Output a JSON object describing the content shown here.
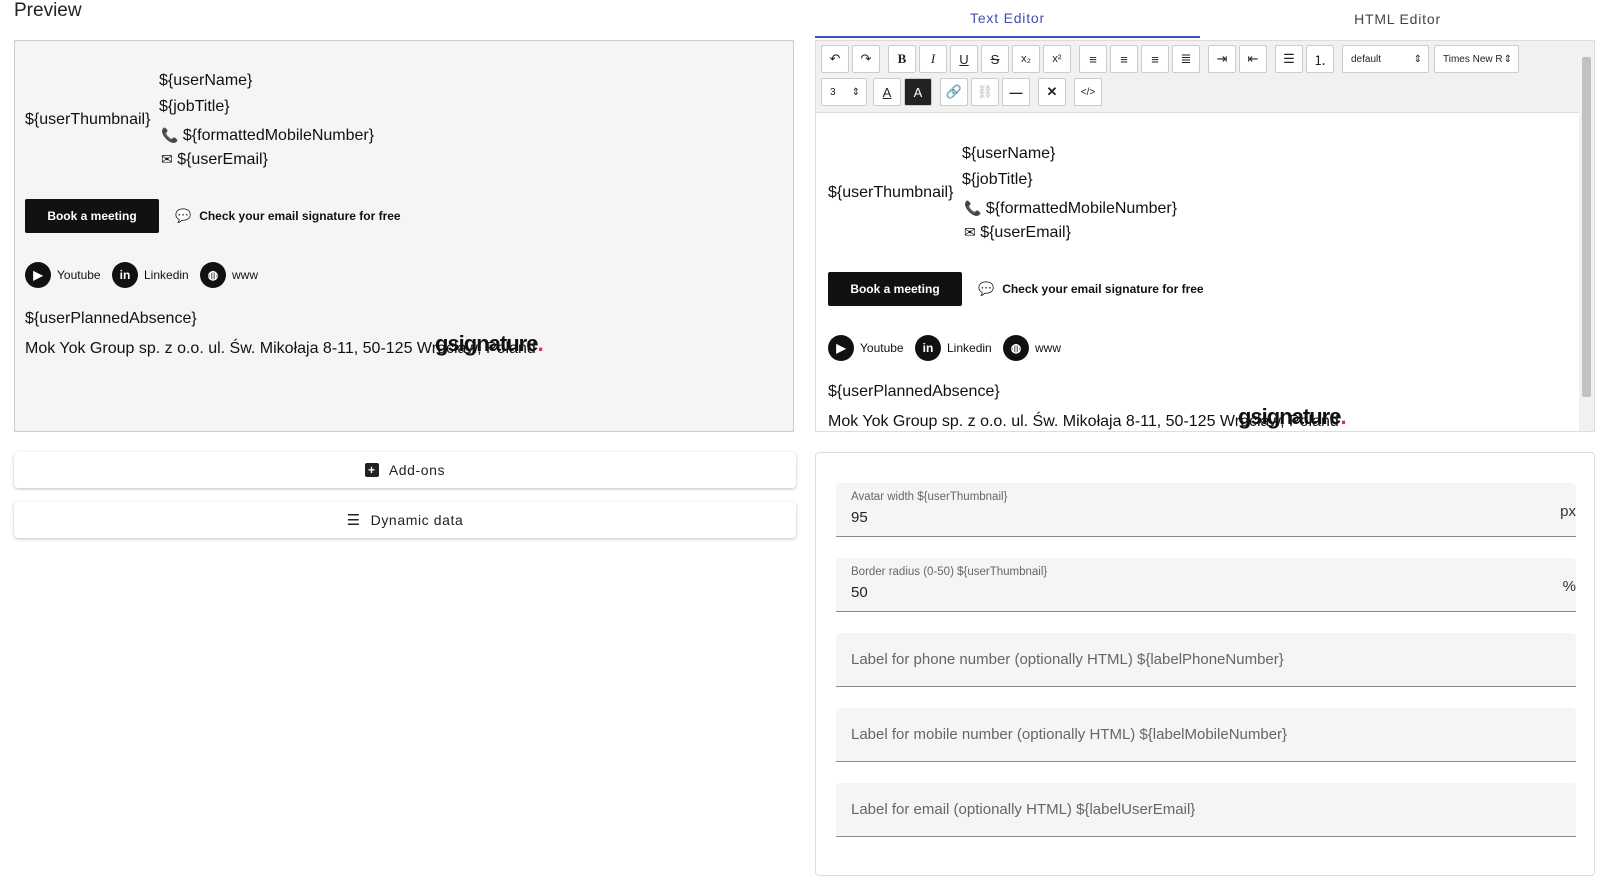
{
  "preview": {
    "title": "Preview",
    "signature": {
      "thumbnail": "${userThumbnail}",
      "user_name": "${userName}",
      "job_title": "${jobTitle}",
      "phone": "${formattedMobileNumber}",
      "email": "${userEmail}",
      "book_button": "Book a meeting",
      "check_link": "Check your email signature for free",
      "socials": [
        {
          "label": "Youtube",
          "icon": "youtube-icon"
        },
        {
          "label": "Linkedin",
          "icon": "linkedin-icon"
        },
        {
          "label": "www",
          "icon": "globe-icon"
        }
      ],
      "planned_absence": "${userPlannedAbsence}",
      "address": "Mok Yok Group sp. z o.o. ul. Św. Mikołaja 8-11, 50-125 Wrocław, Poland",
      "logo": "gsignature"
    }
  },
  "panels": {
    "addons": "Add-ons",
    "dynamic_data": "Dynamic data"
  },
  "tabs": {
    "text_editor": "Text Editor",
    "html_editor": "HTML Editor",
    "active": "text_editor"
  },
  "toolbar": {
    "format_select": "default",
    "font_select": "Times New R",
    "size_select": "3"
  },
  "form": {
    "avatar_width": {
      "label": "Avatar width ${userThumbnail}",
      "value": "95",
      "suffix": "px"
    },
    "border_radius": {
      "label": "Border radius (0-50) ${userThumbnail}",
      "value": "50",
      "suffix": "%"
    },
    "label_phone": {
      "placeholder": "Label for phone number (optionally HTML) ${labelPhoneNumber}"
    },
    "label_mobile": {
      "placeholder": "Label for mobile number (optionally HTML) ${labelMobileNumber}"
    },
    "label_email": {
      "placeholder": "Label for email (optionally HTML) ${labelUserEmail}"
    }
  },
  "colors": {
    "accent": "#3f51b5",
    "logo_dot": "#e91e8c"
  }
}
